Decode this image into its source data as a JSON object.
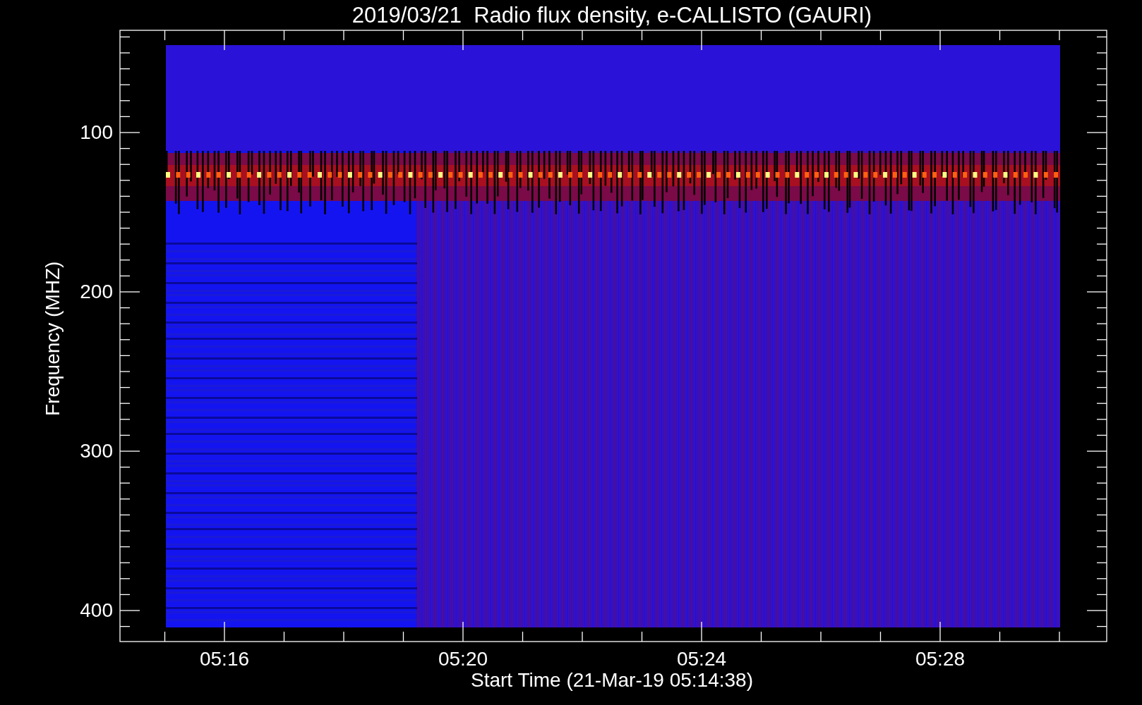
{
  "title": "2019/03/21  Radio flux density, e-CALLISTO (GAURI)",
  "y_axis": {
    "label": "Frequency (MHZ)",
    "ticks": [
      "100",
      "200",
      "300",
      "400"
    ]
  },
  "x_axis": {
    "label": "Start Time (21-Mar-19 05:14:38)",
    "ticks": [
      "05:16",
      "05:20",
      "05:24",
      "05:28"
    ]
  }
}
